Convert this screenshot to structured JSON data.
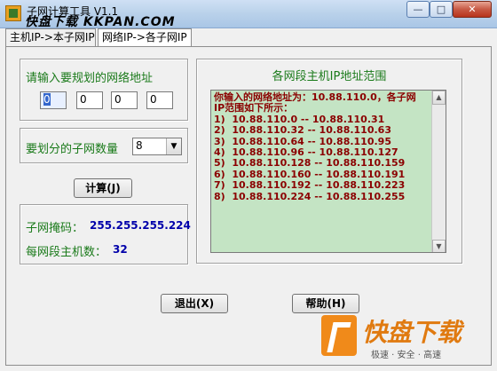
{
  "window": {
    "title": "子网计算工具 V1.1",
    "watermark": "快盘下载 KKPAN.COM",
    "min_glyph": "—",
    "max_glyph": "□",
    "close_glyph": "✕"
  },
  "tabs": [
    {
      "label": "主机IP->本子网IP",
      "active": false
    },
    {
      "label": "网络IP->各子网IP",
      "active": true
    }
  ],
  "input_section": {
    "label": "请输入要规划的网络地址",
    "octets": [
      "0",
      "0",
      "0",
      "0"
    ]
  },
  "subnet_count": {
    "label": "要划分的子网数量",
    "selected": "8"
  },
  "calc_button": "计算(J)",
  "output": {
    "mask_label": "子网掩码：",
    "mask_value": "255.255.255.224",
    "hosts_label": "每网段主机数：",
    "hosts_value": "32"
  },
  "results": {
    "title": "各网段主机IP地址范围",
    "text": "你输入的网络地址为：10.88.110.0，各子网\nIP范围如下所示：\n1)  10.88.110.0 -- 10.88.110.31\n2)  10.88.110.32 -- 10.88.110.63\n3)  10.88.110.64 -- 10.88.110.95\n4)  10.88.110.96 -- 10.88.110.127\n5)  10.88.110.128 -- 10.88.110.159\n6)  10.88.110.160 -- 10.88.110.191\n7)  10.88.110.192 -- 10.88.110.223\n8)  10.88.110.224 -- 10.88.110.255"
  },
  "buttons": {
    "exit": "退出(X)",
    "help": "帮助(H)"
  },
  "logo": {
    "brand": "快盘下载",
    "slogan": "极速 · 安全 · 高速"
  },
  "colors": {
    "label_green": "#1a7a1a",
    "value_blue": "#0000aa",
    "result_text": "#8b0000",
    "result_bg": "#c4e4c4"
  }
}
